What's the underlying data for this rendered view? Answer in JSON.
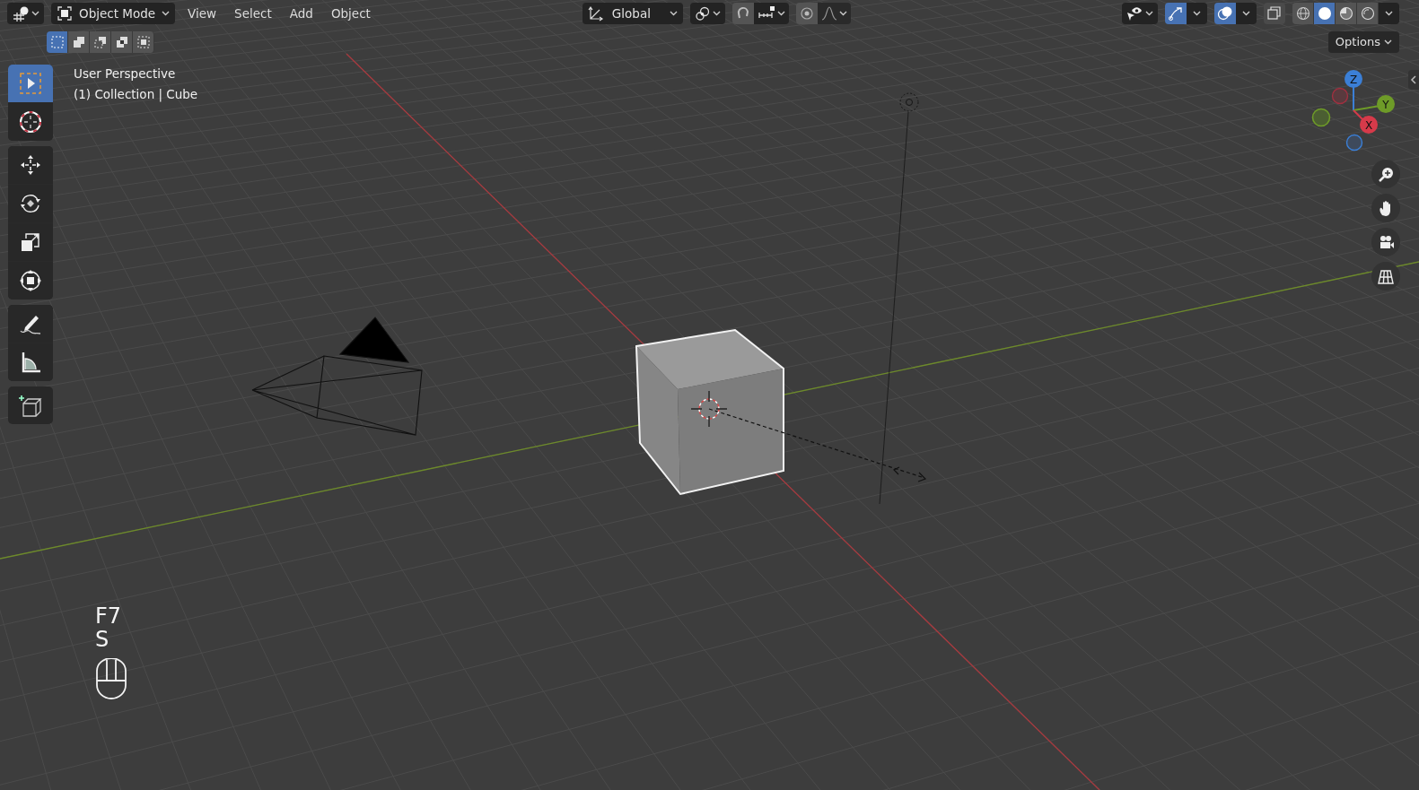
{
  "header": {
    "mode": "Object Mode",
    "menus": [
      "View",
      "Select",
      "Add",
      "Object"
    ],
    "orientation": "Global",
    "toggles": [
      {
        "kind": "gizmo",
        "on": true
      },
      {
        "kind": "overlay",
        "on": true
      },
      {
        "kind": "xray",
        "on": false
      }
    ],
    "shading": [
      {
        "kind": "wireframe",
        "selected": false
      },
      {
        "kind": "solid",
        "selected": true
      },
      {
        "kind": "material",
        "selected": false
      },
      {
        "kind": "rendered",
        "selected": false
      }
    ]
  },
  "select_modes": [
    {
      "kind": "new",
      "selected": true
    },
    {
      "kind": "extend",
      "selected": false
    },
    {
      "kind": "subtract",
      "selected": false
    },
    {
      "kind": "invert",
      "selected": false
    },
    {
      "kind": "intersect",
      "selected": false
    }
  ],
  "options": "Options",
  "toolbar": [
    [
      {
        "kind": "select",
        "selected": true
      },
      {
        "kind": "cursor",
        "selected": false
      }
    ],
    [
      {
        "kind": "move",
        "selected": false
      },
      {
        "kind": "rotate",
        "selected": false
      },
      {
        "kind": "scale",
        "selected": false
      },
      {
        "kind": "transform",
        "selected": false
      }
    ],
    [
      {
        "kind": "annotate",
        "selected": false
      },
      {
        "kind": "measure",
        "selected": false
      }
    ],
    [
      {
        "kind": "add_cube",
        "selected": false
      }
    ]
  ],
  "viewport_info": [
    "User Perspective",
    "(1) Collection | Cube"
  ],
  "gizmo_axes": [
    "Z",
    "Y",
    "X"
  ],
  "keys_pressed": [
    "F7",
    "S"
  ]
}
